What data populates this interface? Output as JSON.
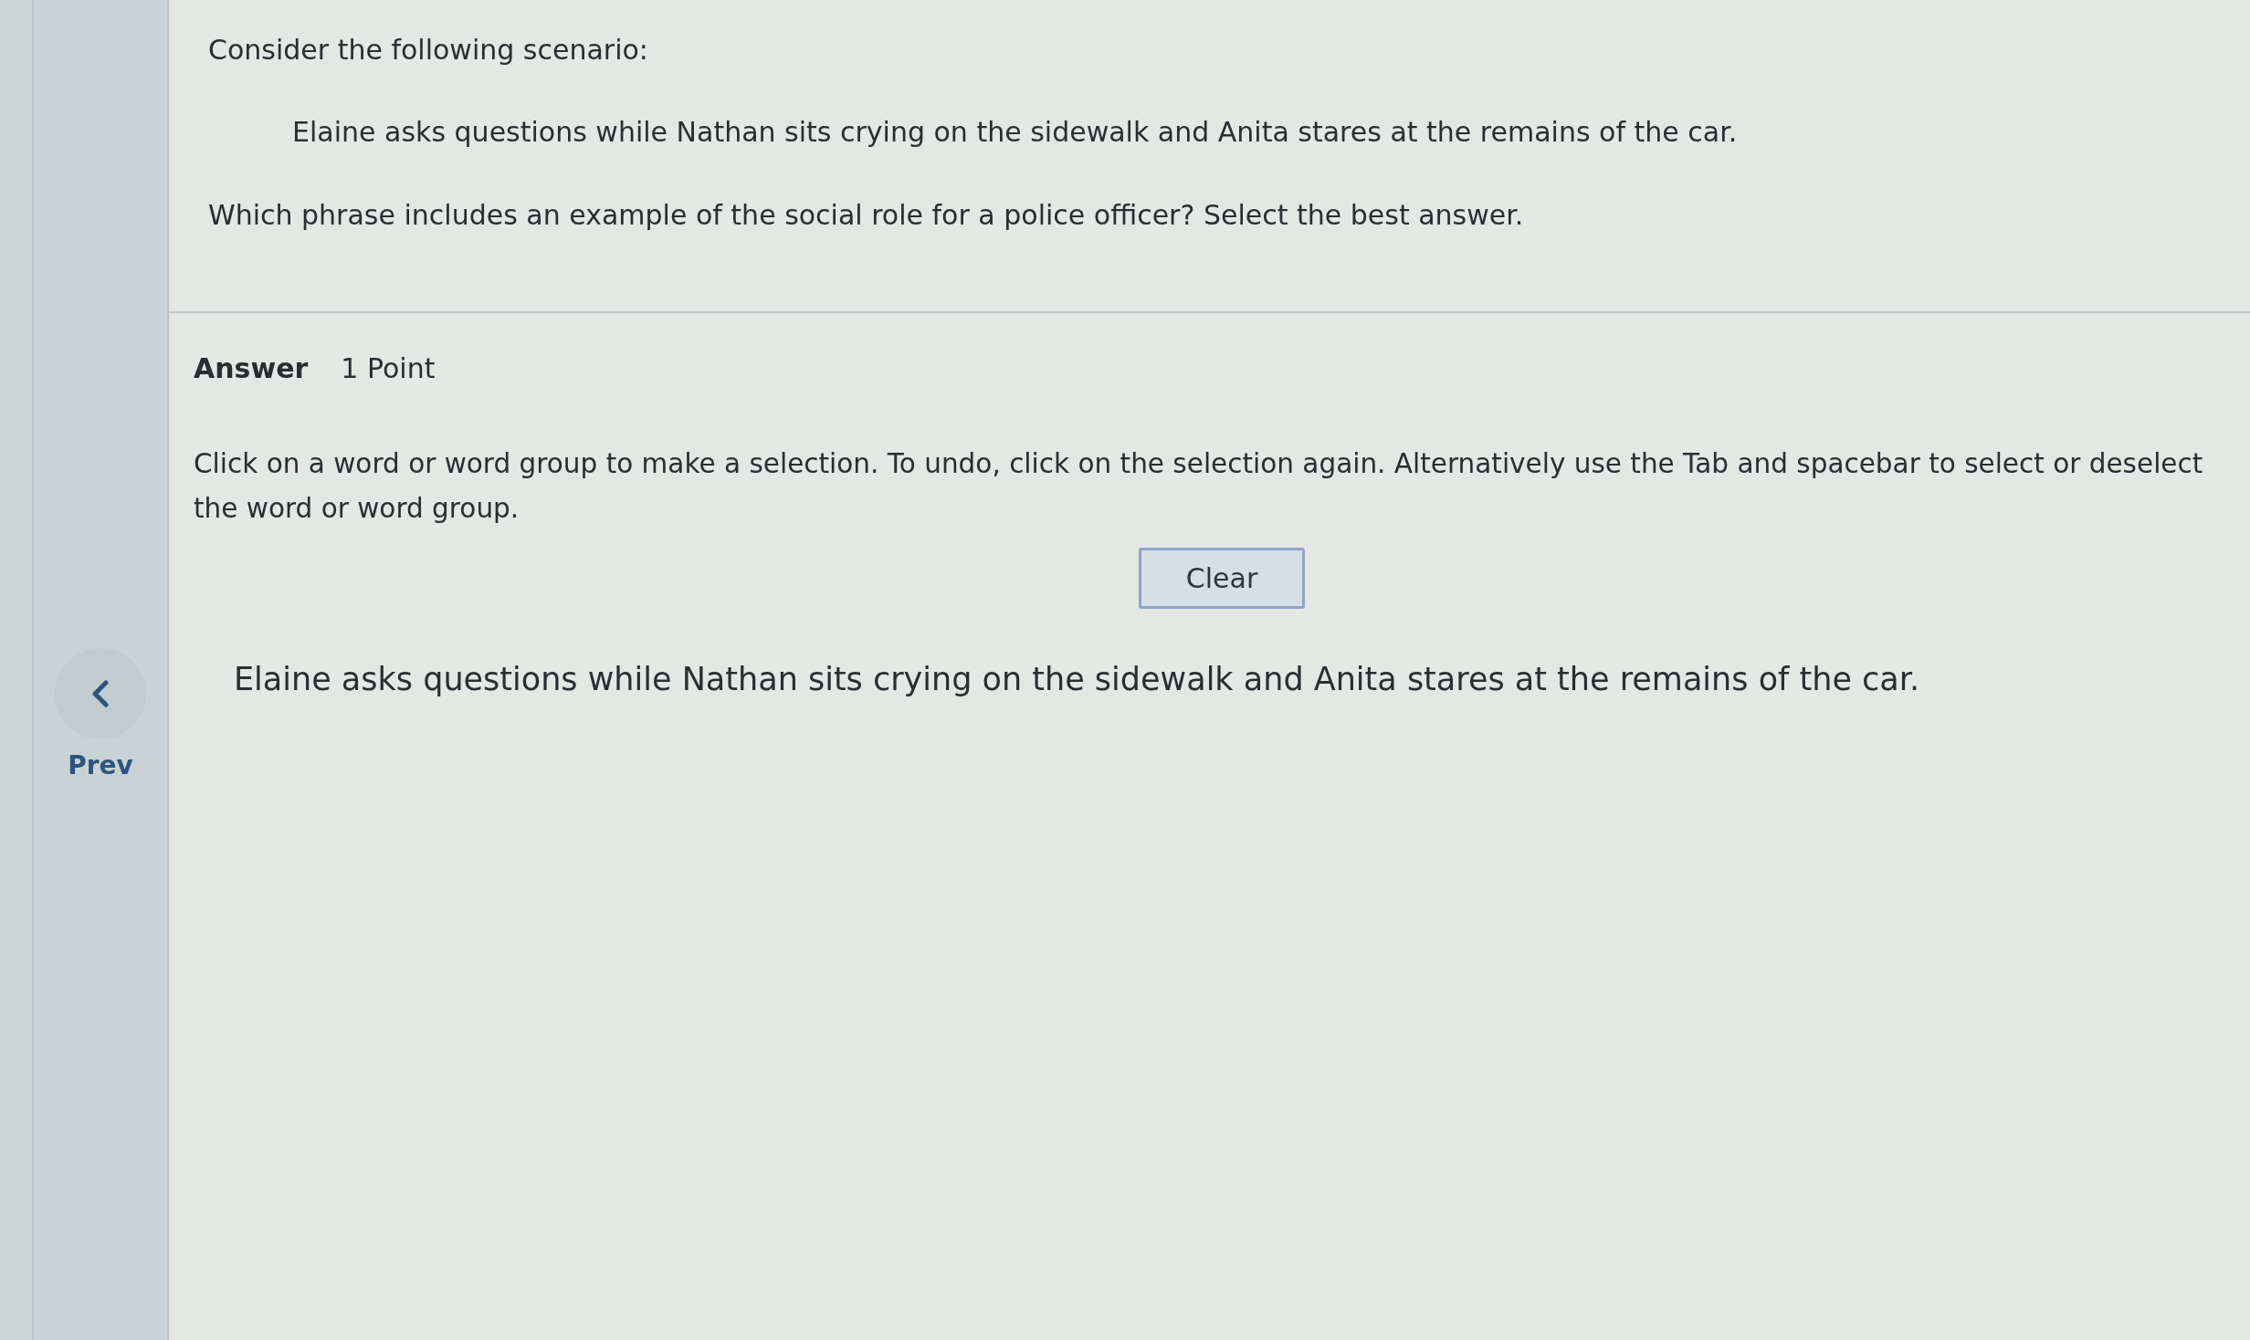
{
  "navigation": {
    "prev_label": "Prev"
  },
  "question": {
    "intro": "Consider the following scenario:",
    "scenario": "Elaine asks questions while Nathan sits crying on the sidewalk and Anita stares at the remains of the car.",
    "prompt": "Which phrase includes an example of the social role for a police officer? Select the best answer."
  },
  "answer": {
    "heading": "Answer",
    "points": "1 Point",
    "instructions": "Click on a word or word group to make a selection. To undo, click on the selection again. Alternatively use the Tab and spacebar to select or deselect the word or word group.",
    "clear_button": "Clear",
    "sentence": "Elaine asks questions while Nathan sits crying on the sidewalk and Anita stares at the remains of the car."
  }
}
